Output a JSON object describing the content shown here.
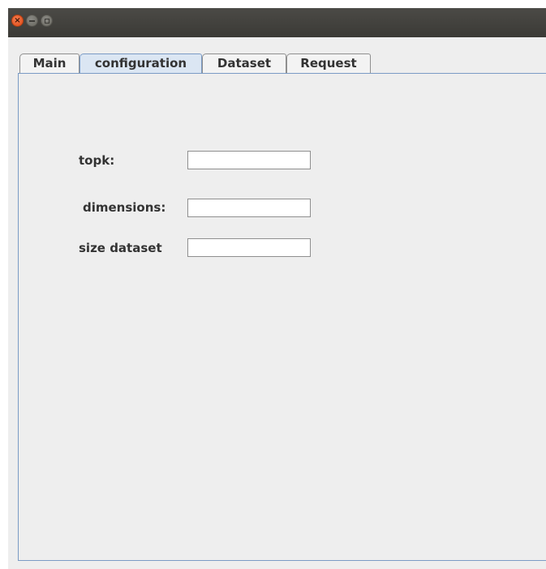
{
  "window": {
    "close_glyph": "×"
  },
  "tabs": [
    {
      "label": "Main",
      "selected": false
    },
    {
      "label": "configuration",
      "selected": true
    },
    {
      "label": "Dataset",
      "selected": false
    },
    {
      "label": "Request",
      "selected": false
    }
  ],
  "form": {
    "topk": {
      "label": "topk:",
      "value": "",
      "placeholder": ""
    },
    "dimensions": {
      "label": "dimensions:",
      "value": "",
      "placeholder": ""
    },
    "size_dataset": {
      "label": "size dataset",
      "value": "",
      "placeholder": ""
    }
  }
}
